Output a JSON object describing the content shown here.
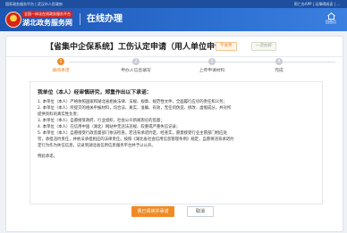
{
  "top_strip": {
    "left_text": "国家政务服务平台 | 武汉市人民政府",
    "right_text": "帮亡办APP | 无障碍阅读 | ..."
  },
  "banner": {
    "logo_line1": "全国一体化在线政务服务平台",
    "logo_line2": "湖北政务服务网",
    "section_title": "在线办理",
    "home_label": "回首页"
  },
  "page": {
    "title": "【省集中企保系统】工伤认定申请（用人单位申请）",
    "badge_not_promised": "不收费",
    "badge_visit": "一次办好"
  },
  "steps": [
    {
      "num": "1",
      "label": "填阅承诺",
      "active": true
    },
    {
      "num": "2",
      "label": "申办人信息填写",
      "active": false
    },
    {
      "num": "3",
      "label": "上传申请材料",
      "active": false
    },
    {
      "num": "4",
      "label": "完成",
      "active": false
    }
  ],
  "commitment": {
    "heading": "我单位（本人）经审慎研究，郑重作出以下承诺：",
    "items": [
      "1. 本单位（本人）严格依照国家和湖北省相关法律、法规、规章、规范性文件，全面履行应尽的责任和义务；",
      "2. 本单位（本人）所提交的相关申报材料，均合法、真实、准确、有效，无任何伪造、修改、虚假成分，并对所",
      "提供资料的真实性负责；",
      "3. 本单位（本人）自愿接受政府、行业组织、社会公众新闻舆论的监督；",
      "4. 本单位（本人）在信用中国（湖北）网站中无违法违规、较重或严重失信记录；",
      "5. 本单位（本人）自愿接受行政监督部门依法检查。若违背承诺约定，经查实，愿意接受行业主管部门相应处",
      "罚，承担违约责任，并依法承担相应的法律责任。按照《湖北省社会信用信息管理条例》规定，自愿将违背承诺约",
      "定行为作为失信信息，记录到湖北省信用信息服务平台并予以公开。",
      "特此承诺。"
    ]
  },
  "buttons": {
    "primary": "我已阅读并承诺",
    "cancel": "取消"
  }
}
